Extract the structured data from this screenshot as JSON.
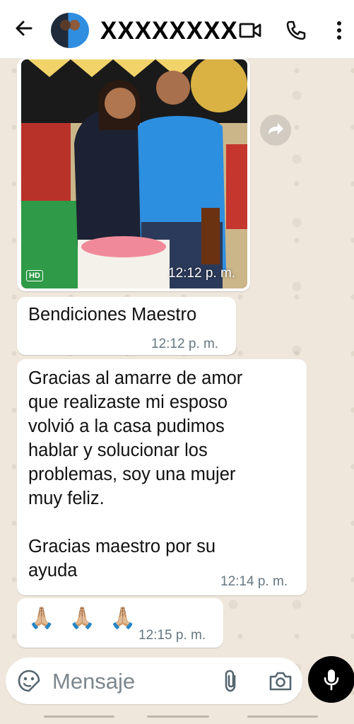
{
  "header": {
    "contact_name": "XXXXXXXX"
  },
  "messages": [
    {
      "type": "image",
      "time": "12:12 p. m.",
      "badge": "HD"
    },
    {
      "type": "text",
      "text": "Bendiciones  Maestro",
      "time": "12:12 p. m."
    },
    {
      "type": "text",
      "lines": [
        "Gracias al amarre  de amor",
        "que realizaste  mi esposo",
        "volvió  a la casa  pudimos",
        "hablar y solucionar  los",
        "problemas, soy una mujer",
        "muy feliz.",
        "",
        "Gracias maestro por su",
        "ayuda"
      ],
      "time": "12:14 p. m."
    },
    {
      "type": "text",
      "text": "🙏🏼 🙏🏼 🙏🏼",
      "time": "12:15 p. m."
    }
  ],
  "input": {
    "placeholder": "Mensaje"
  },
  "colors": {
    "header_bg": "#ffffff",
    "wallpaper": "#efe7dc",
    "bubble": "#ffffff",
    "timestamp": "#667781",
    "mic_button": "#000000"
  },
  "icons": {
    "back": "arrow-left-icon",
    "video": "video-camera-icon",
    "call": "phone-icon",
    "menu": "more-vertical-icon",
    "forward": "forward-icon",
    "emoji": "sticker-icon",
    "attach": "paperclip-icon",
    "camera": "camera-icon",
    "mic": "microphone-icon"
  }
}
